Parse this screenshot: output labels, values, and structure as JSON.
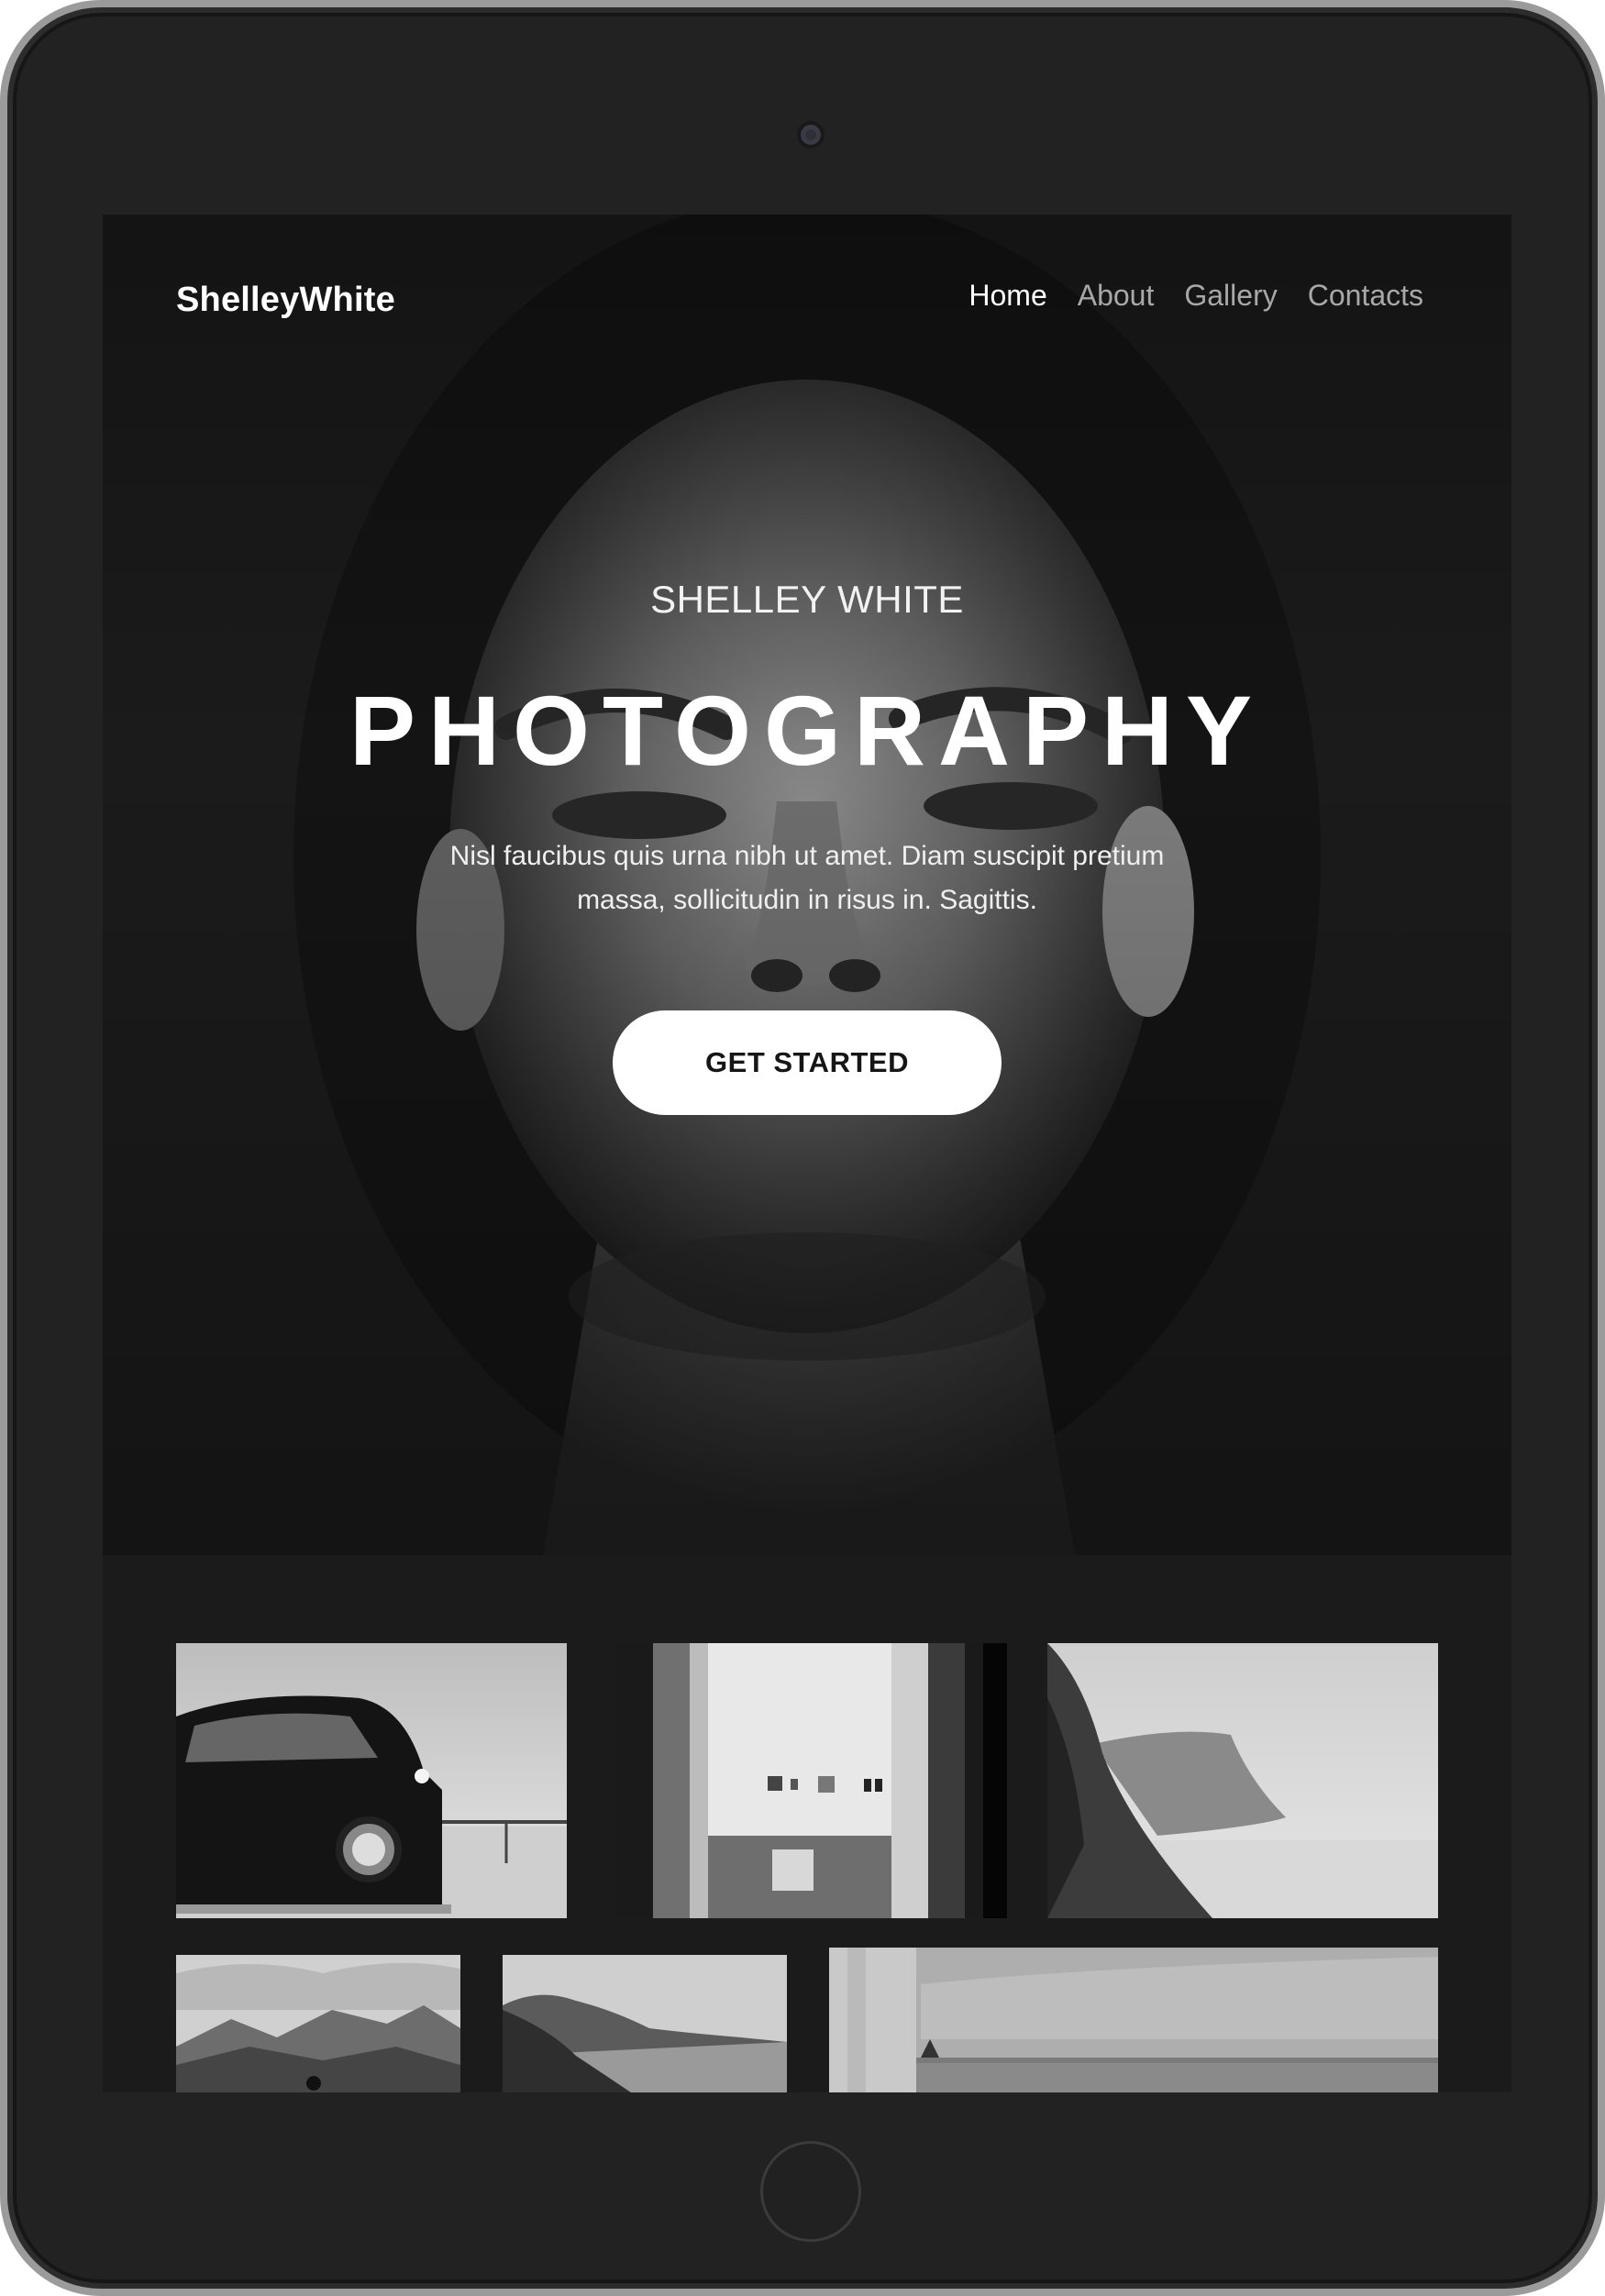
{
  "site": {
    "logo": "ShelleyWhite"
  },
  "nav": {
    "items": [
      {
        "label": "Home",
        "active": true
      },
      {
        "label": "About",
        "active": false
      },
      {
        "label": "Gallery",
        "active": false
      },
      {
        "label": "Contacts",
        "active": false
      }
    ]
  },
  "hero": {
    "subtitle": "SHELLEY WHITE",
    "title": "PHOTOGRAPHY",
    "text": "Nisl faucibus quis urna nibh ut amet. Diam suscipit pretium massa, sollicitudin in risus in. Sagittis.",
    "cta_label": "GET STARTED"
  },
  "gallery": {
    "photos": [
      "car-photo",
      "gallery-interior-photo",
      "coastal-cliff-photo",
      "mountains-photo",
      "lake-photo",
      "concrete-wall-photo"
    ]
  },
  "colors": {
    "frame": "#222223",
    "screen": "#1b1b1b",
    "text": "#ffffff",
    "nav_inactive": "#a8a8a8"
  }
}
